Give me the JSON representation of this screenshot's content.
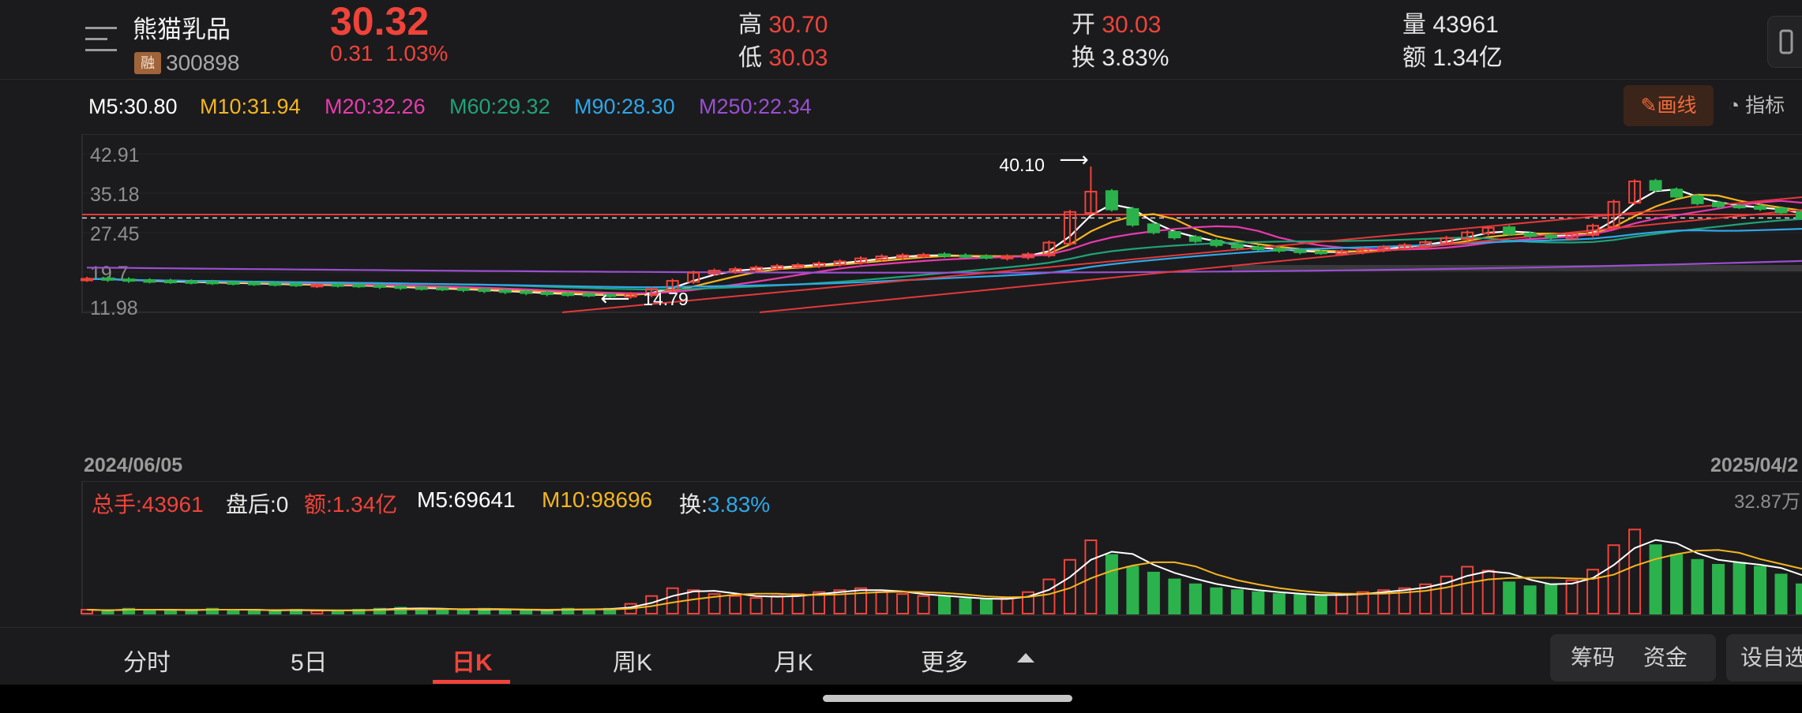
{
  "header": {
    "stock_name": "熊猫乳品",
    "margin_badge": "融",
    "stock_code": "300898",
    "price": "30.32",
    "change": "0.31",
    "change_pct": "1.03%",
    "high_label": "高",
    "high": "30.70",
    "low_label": "低",
    "low": "30.03",
    "open_label": "开",
    "open": "30.03",
    "turnover_label": "换",
    "turnover": "3.83%",
    "volume_label": "量",
    "volume": "43961",
    "amount_label": "额",
    "amount": "1.34亿"
  },
  "ma_row": {
    "items": [
      "M5:30.80",
      "M10:31.94",
      "M20:32.26",
      "M60:29.32",
      "M90:28.30",
      "M250:22.34"
    ],
    "draw_label": "画线",
    "indicator_label": "指标"
  },
  "colors": {
    "up": "#f0433a",
    "down": "#2bb24c",
    "m5": "#ffffff",
    "m10": "#f5b521",
    "m20": "#e83bb0",
    "m60": "#20a277",
    "m90": "#2fa7e8",
    "m250": "#9a4fd0"
  },
  "chart_data": {
    "type": "candlestick",
    "y_ticks": [
      "42.91",
      "35.18",
      "27.45",
      "19.7",
      "11.98"
    ],
    "ylim": [
      11.98,
      42.91
    ],
    "start_date": "2024/06/05",
    "end_date": "2025/04/2",
    "max_label": "40.10",
    "min_label": "14.79",
    "current_price": 30.32,
    "price_points": [
      18.4,
      18.2,
      18.0,
      17.9,
      17.8,
      17.7,
      17.6,
      17.5,
      17.4,
      17.3,
      17.2,
      17.2,
      17.1,
      17.0,
      16.8,
      16.6,
      16.5,
      16.4,
      16.2,
      16.0,
      15.8,
      15.6,
      15.4,
      15.3,
      15.2,
      15.1,
      15.4,
      16.4,
      18.0,
      19.6,
      20.0,
      20.3,
      20.6,
      20.9,
      21.1,
      21.4,
      21.8,
      22.4,
      22.8,
      23.0,
      23.1,
      22.9,
      22.7,
      22.6,
      22.8,
      23.2,
      25.5,
      31.5,
      35.5,
      32.0,
      29.0,
      27.5,
      26.5,
      25.8,
      25.0,
      24.5,
      24.2,
      23.9,
      23.6,
      23.5,
      23.8,
      24.2,
      24.6,
      25.0,
      25.6,
      26.4,
      27.5,
      28.4,
      27.2,
      26.8,
      26.5,
      27.2,
      28.8,
      33.5,
      37.5,
      35.8,
      34.5,
      33.2,
      32.6,
      32.5,
      32.1,
      31.4,
      30.32
    ],
    "volume": {
      "total_label": "总手:43961",
      "after_hours_label": "盘后:0",
      "amount_label": "额:1.34亿",
      "m5_label": "M5:69641",
      "m10_label": "M10:98696",
      "turnover_prefix": "换:",
      "turnover_value": "3.83%",
      "max_label": "32.87万",
      "bars": [
        0.04,
        0.03,
        0.05,
        0.04,
        0.03,
        0.04,
        0.05,
        0.03,
        0.04,
        0.03,
        0.04,
        0.03,
        0.03,
        0.04,
        0.05,
        0.06,
        0.05,
        0.04,
        0.04,
        0.05,
        0.04,
        0.03,
        0.04,
        0.05,
        0.04,
        0.05,
        0.1,
        0.18,
        0.26,
        0.24,
        0.2,
        0.18,
        0.16,
        0.18,
        0.2,
        0.22,
        0.24,
        0.26,
        0.22,
        0.2,
        0.18,
        0.17,
        0.15,
        0.14,
        0.16,
        0.22,
        0.35,
        0.55,
        0.75,
        0.6,
        0.48,
        0.42,
        0.35,
        0.3,
        0.26,
        0.24,
        0.22,
        0.2,
        0.19,
        0.18,
        0.2,
        0.22,
        0.24,
        0.26,
        0.3,
        0.38,
        0.48,
        0.44,
        0.32,
        0.28,
        0.3,
        0.34,
        0.45,
        0.7,
        0.86,
        0.7,
        0.6,
        0.55,
        0.5,
        0.52,
        0.48,
        0.4,
        0.3
      ]
    }
  },
  "tabs": [
    "分时",
    "5日",
    "日K",
    "周K",
    "月K",
    "更多"
  ],
  "side_buttons": [
    "筹码",
    "资金",
    "设自选"
  ]
}
